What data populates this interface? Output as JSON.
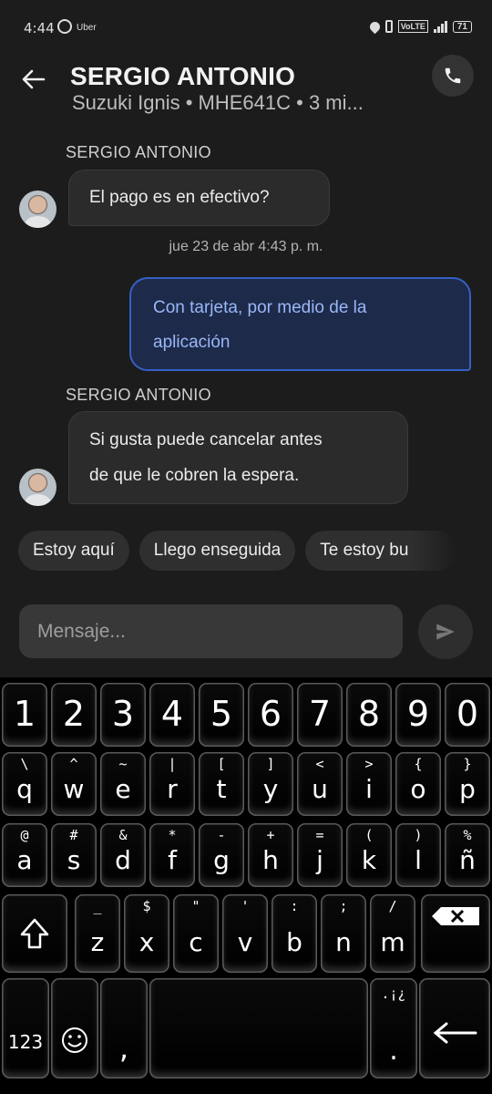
{
  "status_bar": {
    "time": "4:44",
    "app_label": "Uber",
    "volte": "VoLTE",
    "battery": "71"
  },
  "header": {
    "name": "SERGIO ANTONIO",
    "subtitle": "Suzuki Ignis • MHE641C • 3 mi..."
  },
  "messages": [
    {
      "sender": "SERGIO ANTONIO",
      "text": "El pago es en efectivo?"
    },
    {
      "timestamp": "jue 23 de abr 4:43 p. m."
    },
    {
      "text_line1": "Con tarjeta, por medio de la",
      "text_line2": "aplicación"
    },
    {
      "sender": "SERGIO ANTONIO",
      "text_line1": "Si gusta puede cancelar antes",
      "text_line2": "de que le cobren la espera."
    }
  ],
  "quick_replies": [
    "Estoy aquí",
    "Llego enseguida",
    "Te estoy bu"
  ],
  "composer": {
    "placeholder": "Mensaje..."
  },
  "keyboard": {
    "numbers": [
      "1",
      "2",
      "3",
      "4",
      "5",
      "6",
      "7",
      "8",
      "9",
      "0"
    ],
    "row1": [
      {
        "s": "\\",
        "m": "q"
      },
      {
        "s": "^",
        "m": "w"
      },
      {
        "s": "~",
        "m": "e"
      },
      {
        "s": "|",
        "m": "r"
      },
      {
        "s": "[",
        "m": "t"
      },
      {
        "s": "]",
        "m": "y"
      },
      {
        "s": "<",
        "m": "u"
      },
      {
        "s": ">",
        "m": "i"
      },
      {
        "s": "{",
        "m": "o"
      },
      {
        "s": "}",
        "m": "p"
      }
    ],
    "row2": [
      {
        "s": "@",
        "m": "a"
      },
      {
        "s": "#",
        "m": "s"
      },
      {
        "s": "&",
        "m": "d"
      },
      {
        "s": "*",
        "m": "f"
      },
      {
        "s": "-",
        "m": "g"
      },
      {
        "s": "+",
        "m": "h"
      },
      {
        "s": "=",
        "m": "j"
      },
      {
        "s": "(",
        "m": "k"
      },
      {
        "s": ")",
        "m": "l"
      },
      {
        "s": "%",
        "m": "ñ"
      }
    ],
    "row3": [
      {
        "s": "_",
        "m": "z"
      },
      {
        "s": "$",
        "m": "x"
      },
      {
        "s": "\"",
        "m": "c"
      },
      {
        "s": "'",
        "m": "v"
      },
      {
        "s": ":",
        "m": "b"
      },
      {
        "s": ";",
        "m": "n"
      },
      {
        "s": "/",
        "m": "m"
      }
    ],
    "sym_key": "123",
    "comma": ",",
    "period_sec": ".¡¿",
    "period": "."
  },
  "colors": {
    "accent_border": "#3560c4",
    "accent_text": "#9ab7f7",
    "outgoing_bg": "#1d2a4a"
  }
}
